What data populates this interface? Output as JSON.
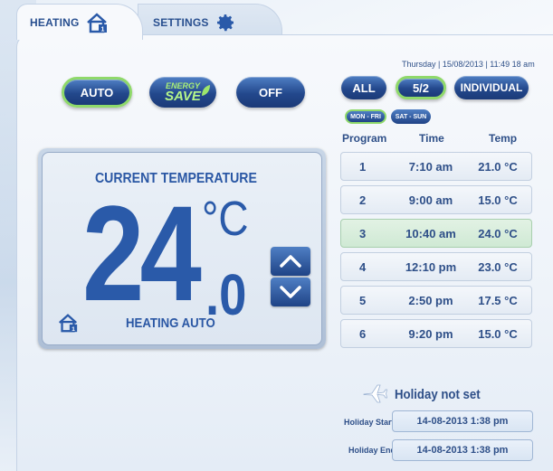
{
  "tabs": {
    "heating": "HEATING",
    "settings": "SETTINGS"
  },
  "mode_buttons": {
    "auto": "AUTO",
    "energy_line1": "ENERGY",
    "energy_line2": "SAVE",
    "off": "OFF",
    "active": "auto"
  },
  "datetime": {
    "day": "Thursday",
    "date": "15/08/2013",
    "time": "11:49",
    "suffix": "18 am"
  },
  "schedule_buttons": {
    "all": "ALL",
    "five_two": "5/2",
    "individual": "INDIVIDUAL",
    "mon_fri": "MON - FRI",
    "sat_sun": "SAT - SUN"
  },
  "temperature": {
    "label": "CURRENT TEMPERATURE",
    "integer": "24",
    "unit": "°C",
    "decimal": ".0",
    "status": "HEATING AUTO"
  },
  "program": {
    "headers": {
      "program": "Program",
      "time": "Time",
      "temp": "Temp"
    },
    "rows": [
      {
        "num": "1",
        "time": "7:10 am",
        "temp": "21.0 °C"
      },
      {
        "num": "2",
        "time": "9:00 am",
        "temp": "15.0 °C"
      },
      {
        "num": "3",
        "time": "10:40 am",
        "temp": "24.0 °C"
      },
      {
        "num": "4",
        "time": "12:10 pm",
        "temp": "23.0 °C"
      },
      {
        "num": "5",
        "time": "2:50 pm",
        "temp": "17.5 °C"
      },
      {
        "num": "6",
        "time": "9:20 pm",
        "temp": "15.0 °C"
      }
    ],
    "active_row": 3
  },
  "holiday": {
    "title": "Holiday not set",
    "start_label": "Holiday Start:",
    "start_value": "14-08-2013 1:38 pm",
    "end_label": "Holiday End:",
    "end_value": "14-08-2013 1:38 pm"
  },
  "colors": {
    "brand_blue": "#2a5aa9",
    "active_green": "#8fd96a"
  }
}
